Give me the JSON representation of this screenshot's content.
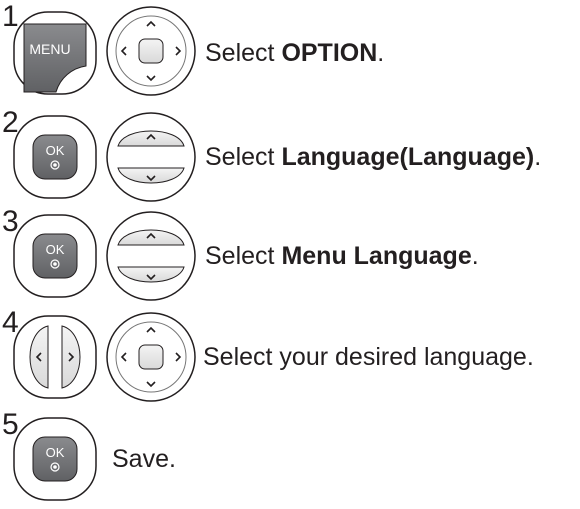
{
  "steps": [
    {
      "number": "1",
      "buttons": [
        "MENU",
        "navigation"
      ],
      "text_prefix": "Select ",
      "text_bold": "OPTION",
      "text_suffix": "."
    },
    {
      "number": "2",
      "buttons": [
        "OK",
        "up-down"
      ],
      "text_prefix": "Select ",
      "text_bold": "Language(Language)",
      "text_suffix": "."
    },
    {
      "number": "3",
      "buttons": [
        "OK",
        "up-down"
      ],
      "text_prefix": "Select ",
      "text_bold": "Menu Language",
      "text_suffix": "."
    },
    {
      "number": "4",
      "buttons": [
        "left-right",
        "navigation"
      ],
      "text_prefix": "Select your desired language.",
      "text_bold": "",
      "text_suffix": ""
    },
    {
      "number": "5",
      "buttons": [
        "OK"
      ],
      "text_prefix": "Save.",
      "text_bold": "",
      "text_suffix": ""
    }
  ],
  "button_labels": {
    "menu": "MENU",
    "ok": "OK"
  },
  "colors": {
    "button_dark": "#757679",
    "button_light": "#eeeeee",
    "outline": "#231f20"
  }
}
